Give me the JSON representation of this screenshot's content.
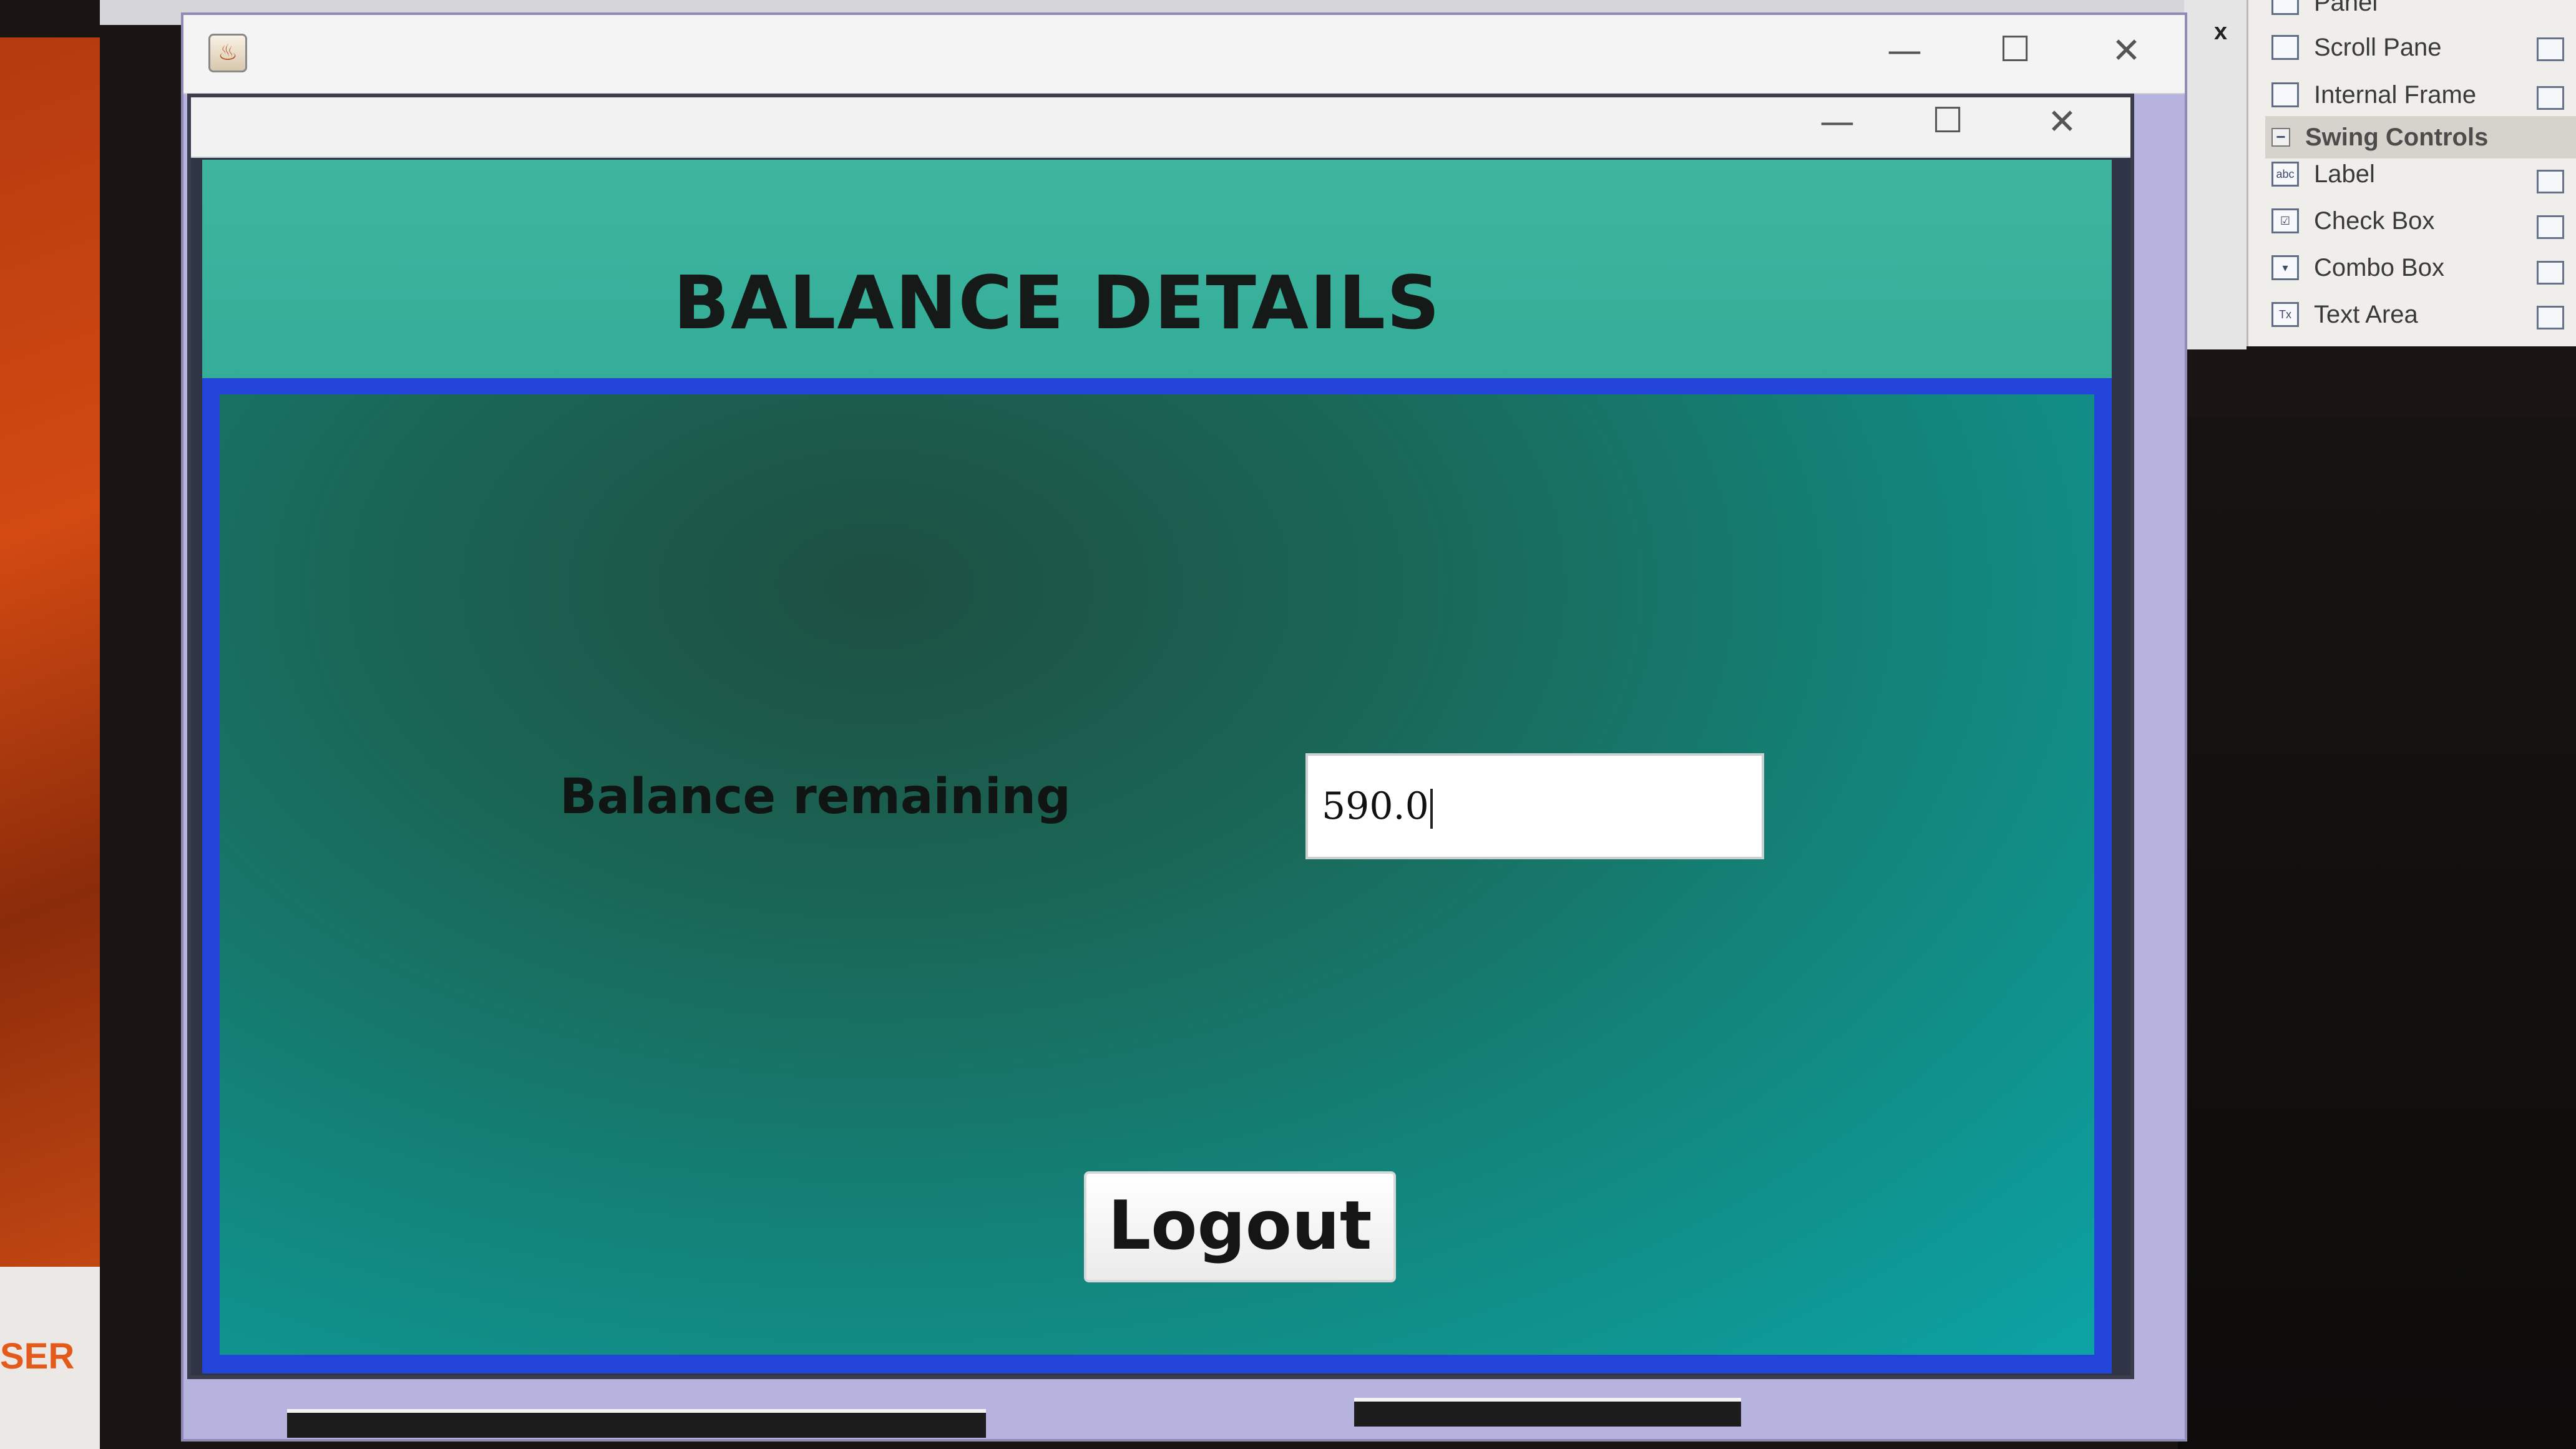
{
  "background": {
    "left_partial_text": "SER"
  },
  "palette": {
    "close_label": "x",
    "items": [
      {
        "label": "Panel",
        "type": "item"
      },
      {
        "label": "Scroll Pane",
        "type": "item"
      },
      {
        "label": "Internal Frame",
        "type": "item"
      },
      {
        "label": "Swing Controls",
        "type": "category"
      },
      {
        "label": "Label",
        "type": "item"
      },
      {
        "label": "Check Box",
        "type": "item"
      },
      {
        "label": "Combo Box",
        "type": "item"
      },
      {
        "label": "Text Area",
        "type": "item"
      }
    ]
  },
  "outer_window": {
    "controls": {
      "minimize": "—",
      "maximize": "☐",
      "close": "✕"
    }
  },
  "app_window": {
    "controls": {
      "minimize": "—",
      "maximize": "☐",
      "close": "✕"
    },
    "header_title": "BALANCE DETAILS",
    "balance_label": "Balance remaining",
    "balance_value": "590.0",
    "logout_label": "Logout"
  },
  "colors": {
    "header_bg": "#3fb59f",
    "panel_border": "#2244d8",
    "content_gradient_end": "#0ca3a5"
  }
}
